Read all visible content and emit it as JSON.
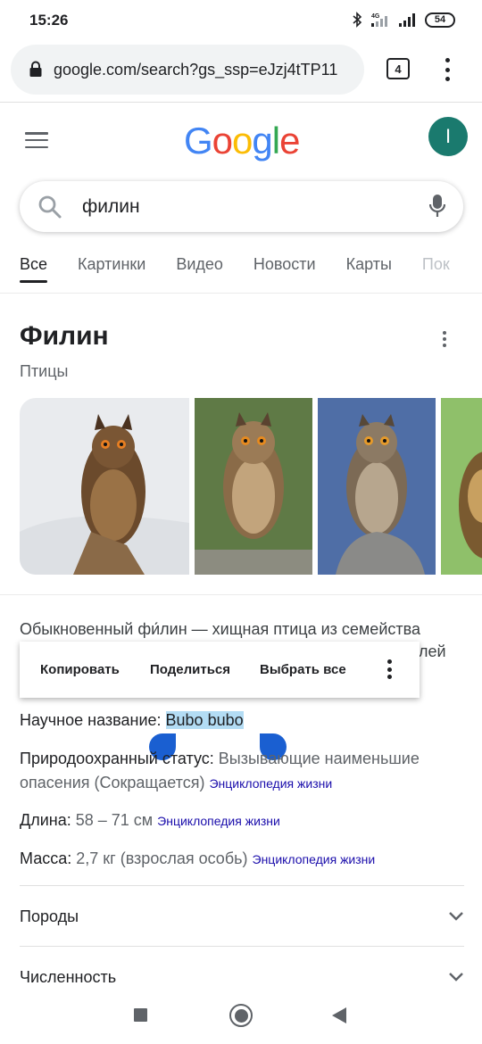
{
  "status_bar": {
    "time": "15:26",
    "network": "4G",
    "battery": "54"
  },
  "browser": {
    "url": "google.com/search?gs_ssp=eJzj4tTP11",
    "tab_count": "4"
  },
  "google": {
    "logo": [
      "G",
      "o",
      "o",
      "g",
      "l",
      "e"
    ],
    "logo_colors": [
      "#4285F4",
      "#EA4335",
      "#FBBC05",
      "#4285F4",
      "#34A853",
      "#EA4335"
    ],
    "avatar_letter": "I",
    "search_query": "филин"
  },
  "tabs": [
    "Все",
    "Картинки",
    "Видео",
    "Новости",
    "Карты",
    "Пок"
  ],
  "knowledge_panel": {
    "title": "Филин",
    "subtitle": "Птицы",
    "description_line1": "Обыкновенный фи́лин — хищная птица из семейства",
    "description_line2_tail": "лей",
    "facts": [
      {
        "label": "Научное название: ",
        "value": "Bubo bubo",
        "source": ""
      },
      {
        "label": "Природоохранный статус: ",
        "value": "Вызывающие наименьшие",
        "source": ""
      },
      {
        "label": "",
        "value": "опасения (Сокращается)",
        "source": "Энциклопедия жизни"
      },
      {
        "label": "Длина: ",
        "value": "58 – 71 см",
        "source": "Энциклопедия жизни"
      },
      {
        "label": "Масса: ",
        "value": "2,7 кг (взрослая особь)",
        "source": "Энциклопедия жизни"
      }
    ],
    "expandables": [
      "Породы",
      "Численность"
    ]
  },
  "selection_menu": {
    "copy": "Копировать",
    "share": "Поделиться",
    "select_all": "Выбрать все"
  }
}
